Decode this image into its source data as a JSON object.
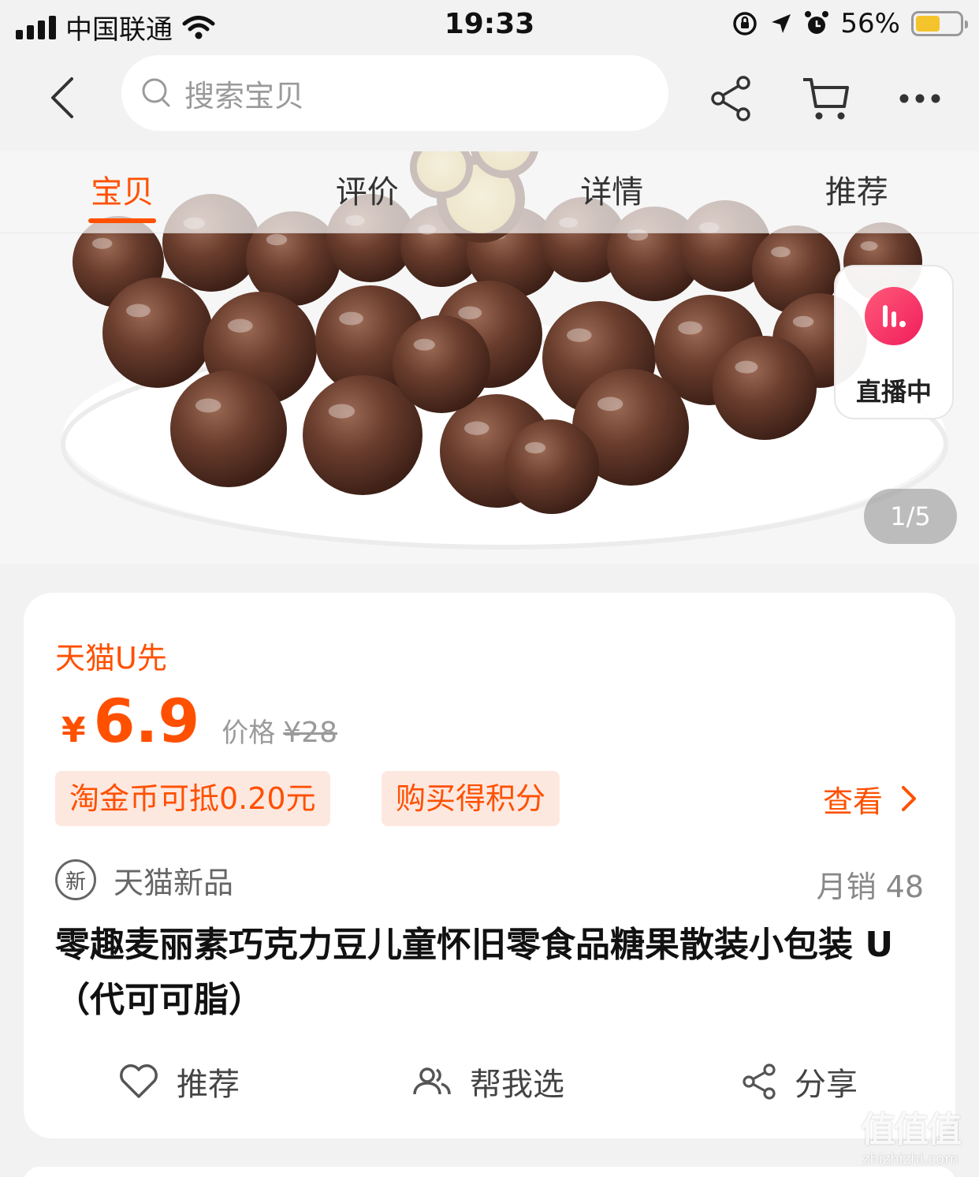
{
  "status_bar": {
    "carrier": "中国联通",
    "time": "19:33",
    "battery_percent": "56%",
    "battery_level": 0.56
  },
  "nav": {
    "search_placeholder": "搜索宝贝"
  },
  "tabs": [
    {
      "label": "宝贝",
      "active": true
    },
    {
      "label": "评价",
      "active": false
    },
    {
      "label": "详情",
      "active": false
    },
    {
      "label": "推荐",
      "active": false
    }
  ],
  "gallery": {
    "live_label": "直播中",
    "pager": "1/5"
  },
  "product": {
    "brand_tag": "天猫U先",
    "currency": "¥",
    "price": "6.9",
    "original_label": "价格",
    "original_price": "¥28",
    "promos": [
      "淘金币可抵0.20元",
      "购买得积分"
    ],
    "view_label": "查看",
    "new_badge": "新",
    "new_label": "天猫新品",
    "monthly_sales": "月销 48",
    "title": "零趣麦丽素巧克力豆儿童怀旧零食品糖果散装小包装 U（代可可脂）"
  },
  "actions": [
    {
      "label": "推荐",
      "icon": "heart-icon"
    },
    {
      "label": "帮我选",
      "icon": "people-icon"
    },
    {
      "label": "分享",
      "icon": "share-icon"
    }
  ],
  "watermark": {
    "glyphs": "值值值",
    "url": "zhizhizhi.com"
  },
  "colors": {
    "accent": "#ff5000",
    "promo_bg": "#fde8e0",
    "page_bg": "#f2f2f2",
    "live_badge": "#f01d5b"
  }
}
